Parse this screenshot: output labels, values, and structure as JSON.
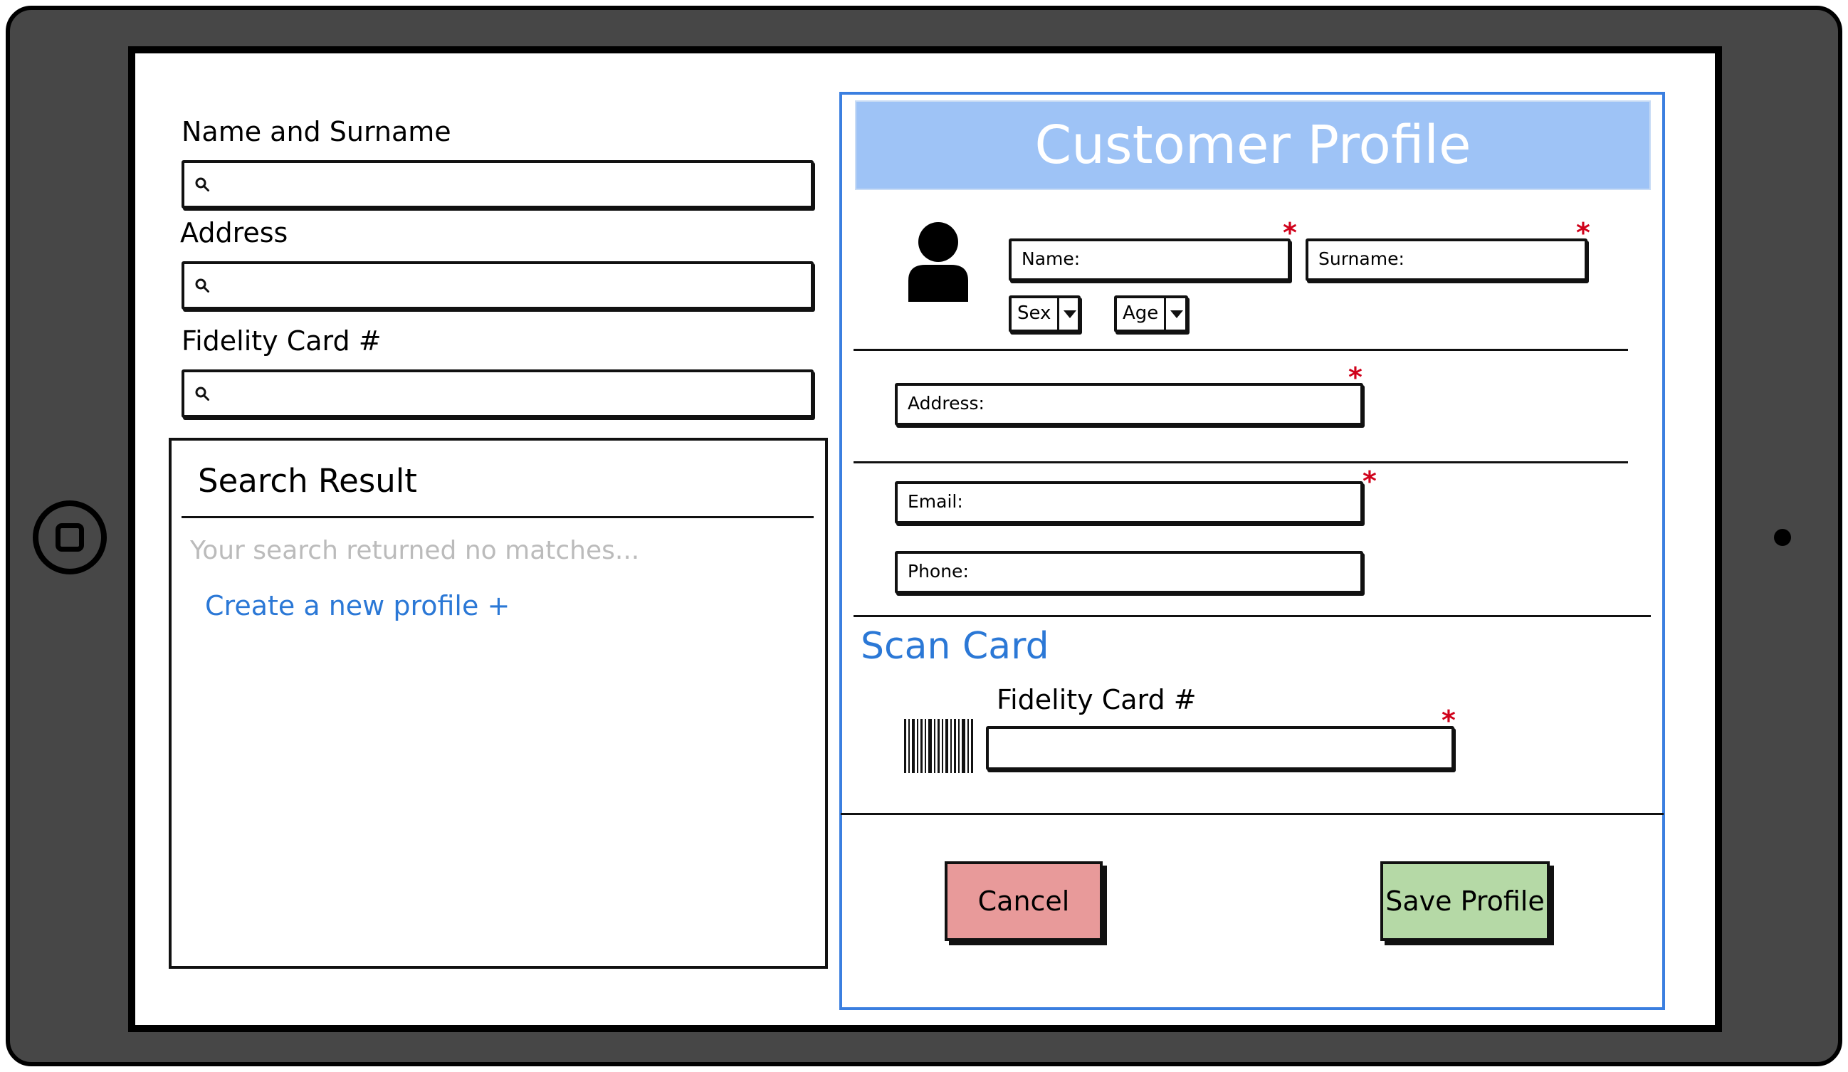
{
  "search": {
    "name_label": "Name and Surname",
    "address_label": "Address",
    "card_label": "Fidelity Card #",
    "name_value": "",
    "address_value": "",
    "card_value": ""
  },
  "results": {
    "title": "Search Result",
    "empty_message": "Your search returned no matches...",
    "create_link": "Create a new profile +"
  },
  "profile": {
    "title": "Customer Profile",
    "name_label": "Name:",
    "surname_label": "Surname:",
    "sex_label": "Sex",
    "age_label": "Age",
    "address_label": "Address:",
    "email_label": "Email:",
    "phone_label": "Phone:",
    "required_mark": "*",
    "scan_title": "Scan Card",
    "card_label": "Fidelity Card #"
  },
  "actions": {
    "cancel_label": "Cancel",
    "save_label": "Save Profile"
  },
  "colors": {
    "accent": "#2b78d6",
    "title_bar": "#9ec3f6",
    "panel_border": "#3b7fe0",
    "cancel_bg": "#e89a9a",
    "save_bg": "#b5d9a6",
    "required": "#d0021b",
    "placeholder_gray": "#bbbbbb",
    "device_frame": "#474747"
  },
  "icons": {
    "search": "search-icon",
    "user": "user-avatar-icon",
    "barcode": "barcode-icon",
    "dropdown": "chevron-down-icon",
    "home": "home-button-icon"
  }
}
